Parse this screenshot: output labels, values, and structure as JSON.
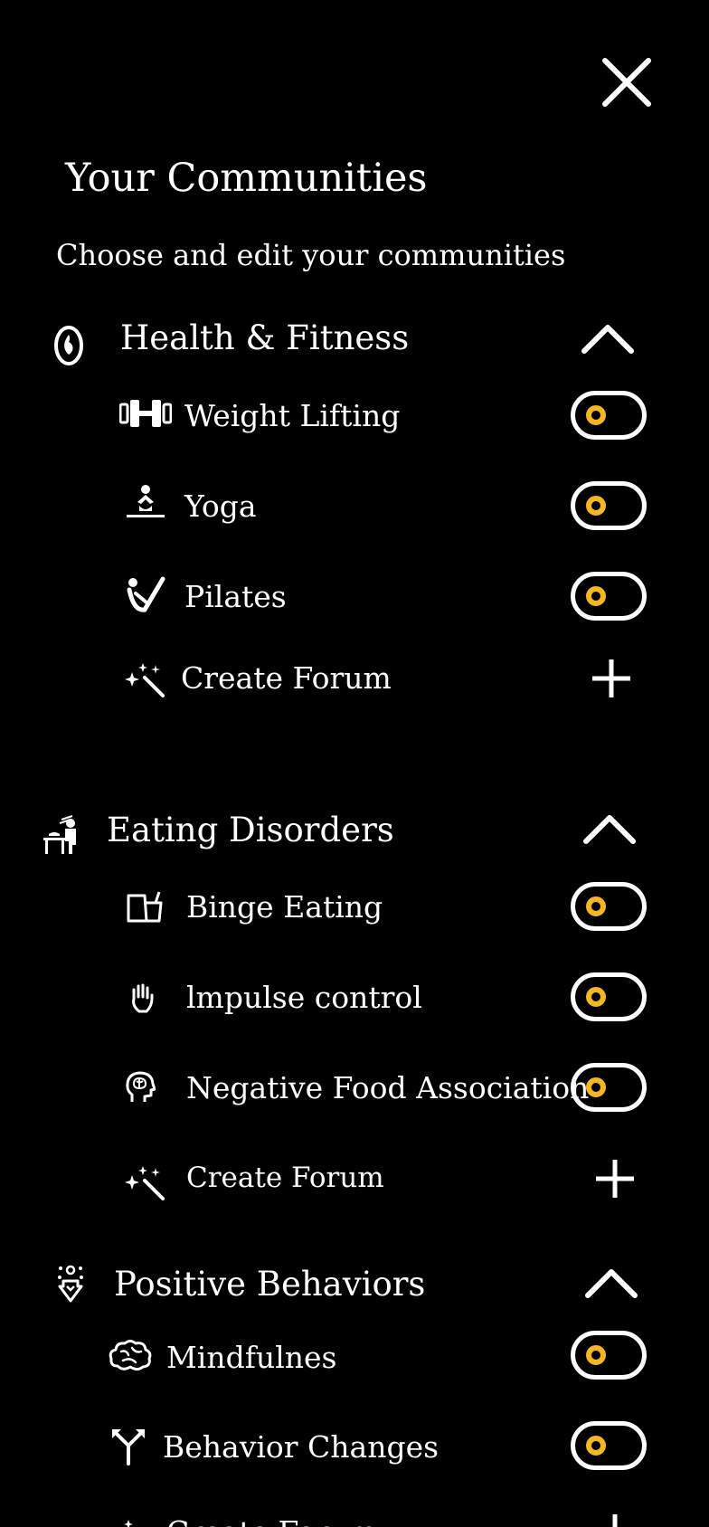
{
  "header": {
    "title": "Your Communities",
    "subtitle": "Choose and edit your communities"
  },
  "accent_color": "#f4b622",
  "groups": [
    {
      "title": "Health & Fitness",
      "icon": "flame-icon",
      "items": [
        {
          "label": "Weight Lifting",
          "icon": "dumbbell-icon",
          "enabled": false
        },
        {
          "label": "Yoga",
          "icon": "yoga-pose-icon",
          "enabled": false
        },
        {
          "label": "Pilates",
          "icon": "pilates-icon",
          "enabled": false
        }
      ],
      "create_label": "Create Forum"
    },
    {
      "title": "Eating Disorders",
      "icon": "eating-person-icon",
      "items": [
        {
          "label": "Binge Eating",
          "icon": "food-containers-icon",
          "enabled": false
        },
        {
          "label": "lmpulse control",
          "icon": "hand-icon",
          "enabled": false
        },
        {
          "label": "Negative Food Association",
          "icon": "brain-head-icon",
          "enabled": false
        }
      ],
      "create_label": "Create Forum"
    },
    {
      "title": "Positive Behaviors",
      "icon": "behavior-icon",
      "items": [
        {
          "label": "Mindfulnes",
          "icon": "brain-icon",
          "enabled": false
        },
        {
          "label": "Behavior Changes",
          "icon": "split-arrows-icon",
          "enabled": false
        }
      ],
      "create_label": "Create Forum"
    }
  ]
}
